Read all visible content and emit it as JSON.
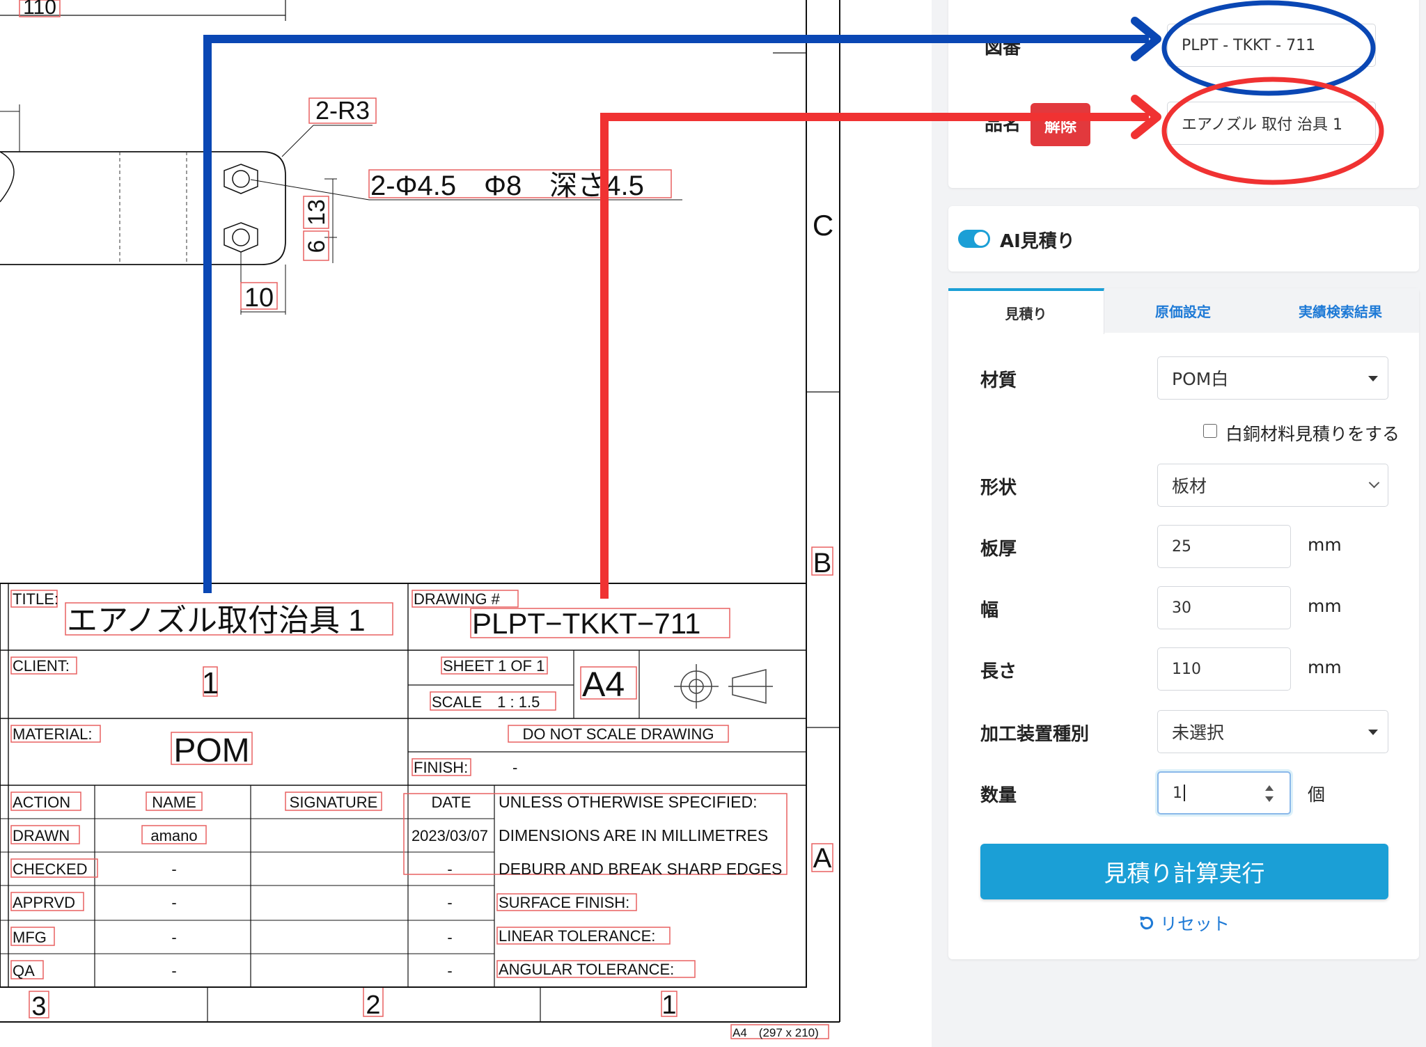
{
  "drawing": {
    "dim_top": "110",
    "dim_r3": "2-R3",
    "dim_hole": "2-Φ4.5　Φ8　深さ4.5",
    "dim_13": "13",
    "dim_6": "6",
    "dim_10": "10",
    "zone_c": "C",
    "zone_b": "B",
    "zone_a": "A",
    "col_3": "3",
    "col_2": "2",
    "col_1": "1",
    "sheet_size": "A4　(297 x 210)",
    "title_block": {
      "title_label": "TITLE:",
      "title_value": "エアノズル取付治具 1",
      "drawing_label": "DRAWING #",
      "drawing_value": "PLPT−TKKT−711",
      "client_label": "CLIENT:",
      "client_value": "1",
      "sheet": "SHEET 1 OF 1",
      "scale": "SCALE　1 : 1.5",
      "paper": "A4",
      "material_label": "MATERIAL:",
      "material_value": "POM",
      "do_not_scale": "DO NOT SCALE DRAWING",
      "finish_label": "FINISH:",
      "finish_value": "-",
      "headers": [
        "ACTION",
        "NAME",
        "SIGNATURE",
        "DATE"
      ],
      "rows": [
        {
          "action": "DRAWN",
          "name": "amano",
          "date": "2023/03/07"
        },
        {
          "action": "CHECKED",
          "name": "-",
          "date": "-"
        },
        {
          "action": "APPRVD",
          "name": "-",
          "date": "-"
        },
        {
          "action": "MFG",
          "name": "-",
          "date": "-"
        },
        {
          "action": "QA",
          "name": "-",
          "date": "-"
        }
      ],
      "notes": [
        "UNLESS OTHERWISE SPECIFIED:",
        "DIMENSIONS ARE IN MILLIMETRES",
        "DEBURR AND BREAK SHARP EDGES",
        "SURFACE FINISH:",
        "LINEAR TOLERANCE:",
        "ANGULAR TOLERANCE:"
      ]
    }
  },
  "panel": {
    "drawing_no_label": "図番",
    "drawing_no_value": "PLPT - TKKT - 711",
    "part_name_label": "品名",
    "release_button": "解除",
    "part_name_value": "エアノズル 取付 治具 1",
    "ai_toggle_label": "AI見積り",
    "tabs": [
      "見積り",
      "原価設定",
      "実績検索結果"
    ],
    "material_label": "材質",
    "material_value": "POM白",
    "cupronickel_checkbox_label": "白銅材料見積りをする",
    "shape_label": "形状",
    "shape_value": "板材",
    "thickness_label": "板厚",
    "thickness_value": "25",
    "width_label": "幅",
    "width_value": "30",
    "length_label": "長さ",
    "length_value": "110",
    "unit_mm": "mm",
    "machine_label": "加工装置種別",
    "machine_value": "未選択",
    "quantity_label": "数量",
    "quantity_value": "1",
    "quantity_unit": "個",
    "submit_button": "見積り計算実行",
    "reset_link": "リセット"
  },
  "colors": {
    "annotation_blue": "#0a47b4",
    "annotation_red": "#f03232",
    "accent": "#1b9fd6",
    "danger": "#e2393d",
    "tab_link": "#1e7ad6",
    "ocr_box": "#e86060"
  }
}
